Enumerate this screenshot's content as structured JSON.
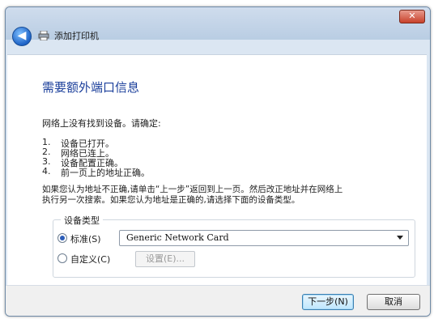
{
  "window": {
    "close_label": "✕",
    "back_label": "◀",
    "title": "添加打印机"
  },
  "page": {
    "heading": "需要额外端口信息",
    "intro": "网络上没有找到设备。请确定:",
    "checklist": [
      {
        "num": "1.",
        "text": "设备已打开。"
      },
      {
        "num": "2.",
        "text": "网络已连上。"
      },
      {
        "num": "3.",
        "text": "设备配置正确。"
      },
      {
        "num": "4.",
        "text": "前一页上的地址正确。"
      }
    ],
    "advice_line1": "如果您认为地址不正确,请单击“上一步”返回到上一页。然后改正地址并在网络上",
    "advice_line2": "执行另一次搜索。如果您认为地址是正确的,请选择下面的设备类型。"
  },
  "device_type": {
    "group_label": "设备类型",
    "standard_label": "标准(S)",
    "standard_selected": true,
    "standard_value": "Generic Network Card",
    "custom_label": "自定义(C)",
    "custom_selected": false,
    "settings_label": "设置(E)..."
  },
  "footer": {
    "next_label": "下一步(N)",
    "cancel_label": "取消"
  },
  "colors": {
    "heading": "#1b3f9b",
    "close_button": "#c8412b",
    "back_button": "#1d62c6"
  }
}
